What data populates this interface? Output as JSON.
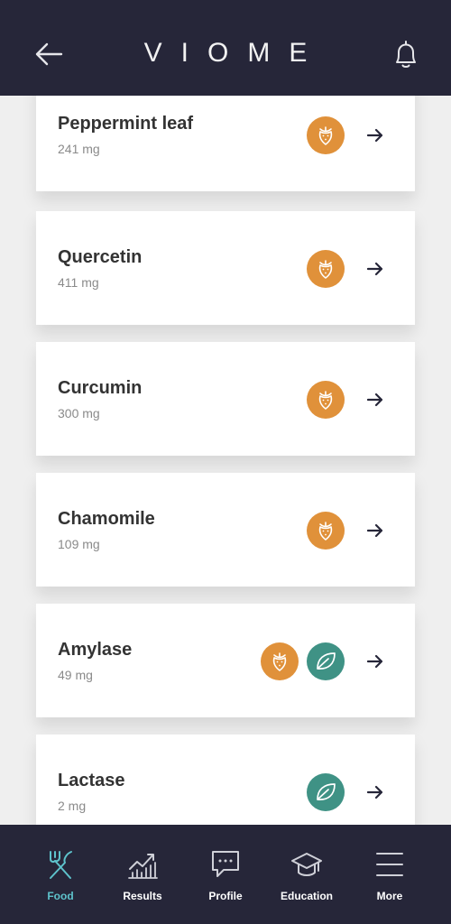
{
  "header": {
    "logo": "VIOME",
    "back_icon": "arrow-left-icon",
    "bell_icon": "bell-icon"
  },
  "colors": {
    "header_bg": "#262639",
    "fruit_badge": "#e0913a",
    "leaf_badge": "#3f9285",
    "active_tab": "#5ec3cc"
  },
  "items": [
    {
      "name": "Peppermint leaf",
      "dose": "241 mg",
      "badges": [
        "strawberry-icon"
      ]
    },
    {
      "name": "Quercetin",
      "dose": "411 mg",
      "badges": [
        "strawberry-icon"
      ]
    },
    {
      "name": "Curcumin",
      "dose": "300 mg",
      "badges": [
        "strawberry-icon"
      ]
    },
    {
      "name": "Chamomile",
      "dose": "109 mg",
      "badges": [
        "strawberry-icon"
      ]
    },
    {
      "name": "Amylase",
      "dose": "49 mg",
      "badges": [
        "strawberry-icon",
        "leaf-icon"
      ]
    },
    {
      "name": "Lactase",
      "dose": "2 mg",
      "badges": [
        "leaf-icon"
      ]
    }
  ],
  "tabs": [
    {
      "label": "Food",
      "icon": "fork-knife-icon",
      "active": true
    },
    {
      "label": "Results",
      "icon": "chart-icon",
      "active": false
    },
    {
      "label": "Profile",
      "icon": "chat-bubble-icon",
      "active": false
    },
    {
      "label": "Education",
      "icon": "graduation-cap-icon",
      "active": false
    },
    {
      "label": "More",
      "icon": "menu-icon",
      "active": false
    }
  ]
}
